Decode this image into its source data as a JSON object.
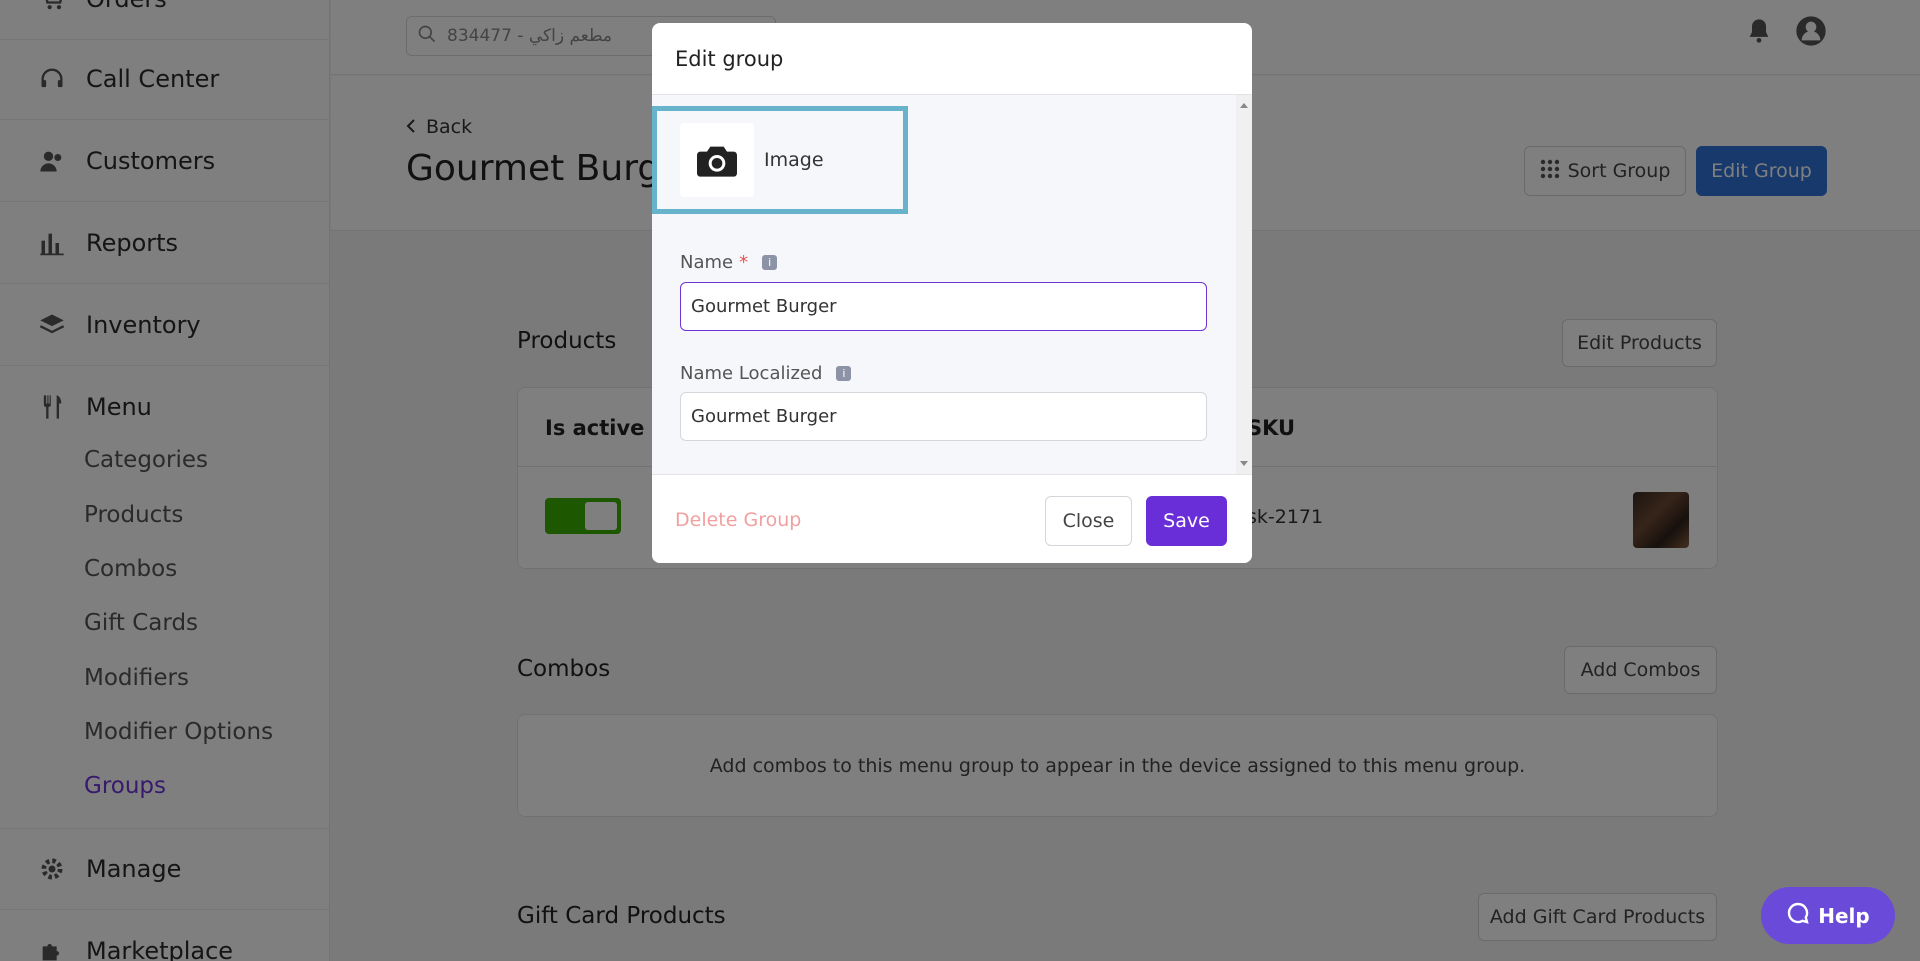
{
  "sidebar": {
    "items": [
      {
        "label": "Orders",
        "icon": "cart-icon"
      },
      {
        "label": "Call Center",
        "icon": "headset-icon"
      },
      {
        "label": "Customers",
        "icon": "users-icon"
      },
      {
        "label": "Reports",
        "icon": "bar-chart-icon"
      },
      {
        "label": "Inventory",
        "icon": "layers-icon"
      },
      {
        "label": "Menu",
        "icon": "utensils-icon"
      },
      {
        "label": "Manage",
        "icon": "gear-icon"
      },
      {
        "label": "Marketplace",
        "icon": "puzzle-icon"
      }
    ],
    "menu_subitems": [
      "Categories",
      "Products",
      "Combos",
      "Gift Cards",
      "Modifiers",
      "Modifier Options",
      "Groups"
    ],
    "active_subitem": "Groups"
  },
  "topbar": {
    "search_value": "مطعم زاكي - 834477"
  },
  "header": {
    "back_label": "Back",
    "title": "Gourmet Burger",
    "sort_group_label": "Sort Group",
    "edit_group_label": "Edit Group"
  },
  "products": {
    "title": "Products",
    "edit_label": "Edit Products",
    "columns": [
      "Is active",
      "SKU"
    ],
    "rows": [
      {
        "is_active": true,
        "sku": "sk-2171"
      }
    ]
  },
  "combos": {
    "title": "Combos",
    "add_label": "Add Combos",
    "empty_text": "Add combos to this menu group to appear in the device assigned to this menu group."
  },
  "gift_cards": {
    "title": "Gift Card Products",
    "add_label": "Add Gift Card Products"
  },
  "modal": {
    "title": "Edit group",
    "image_label": "Image",
    "name_label": "Name",
    "name_required": "*",
    "name_value": "Gourmet Burger",
    "name_localized_label": "Name Localized",
    "name_localized_value": "Gourmet Burger",
    "delete_label": "Delete Group",
    "close_label": "Close",
    "save_label": "Save"
  },
  "help": {
    "label": "Help"
  },
  "colors": {
    "accent": "#6a2ed8",
    "primary_blue": "#2f73d6",
    "active_green": "#3bb000",
    "image_highlight": "#67b3cc"
  }
}
